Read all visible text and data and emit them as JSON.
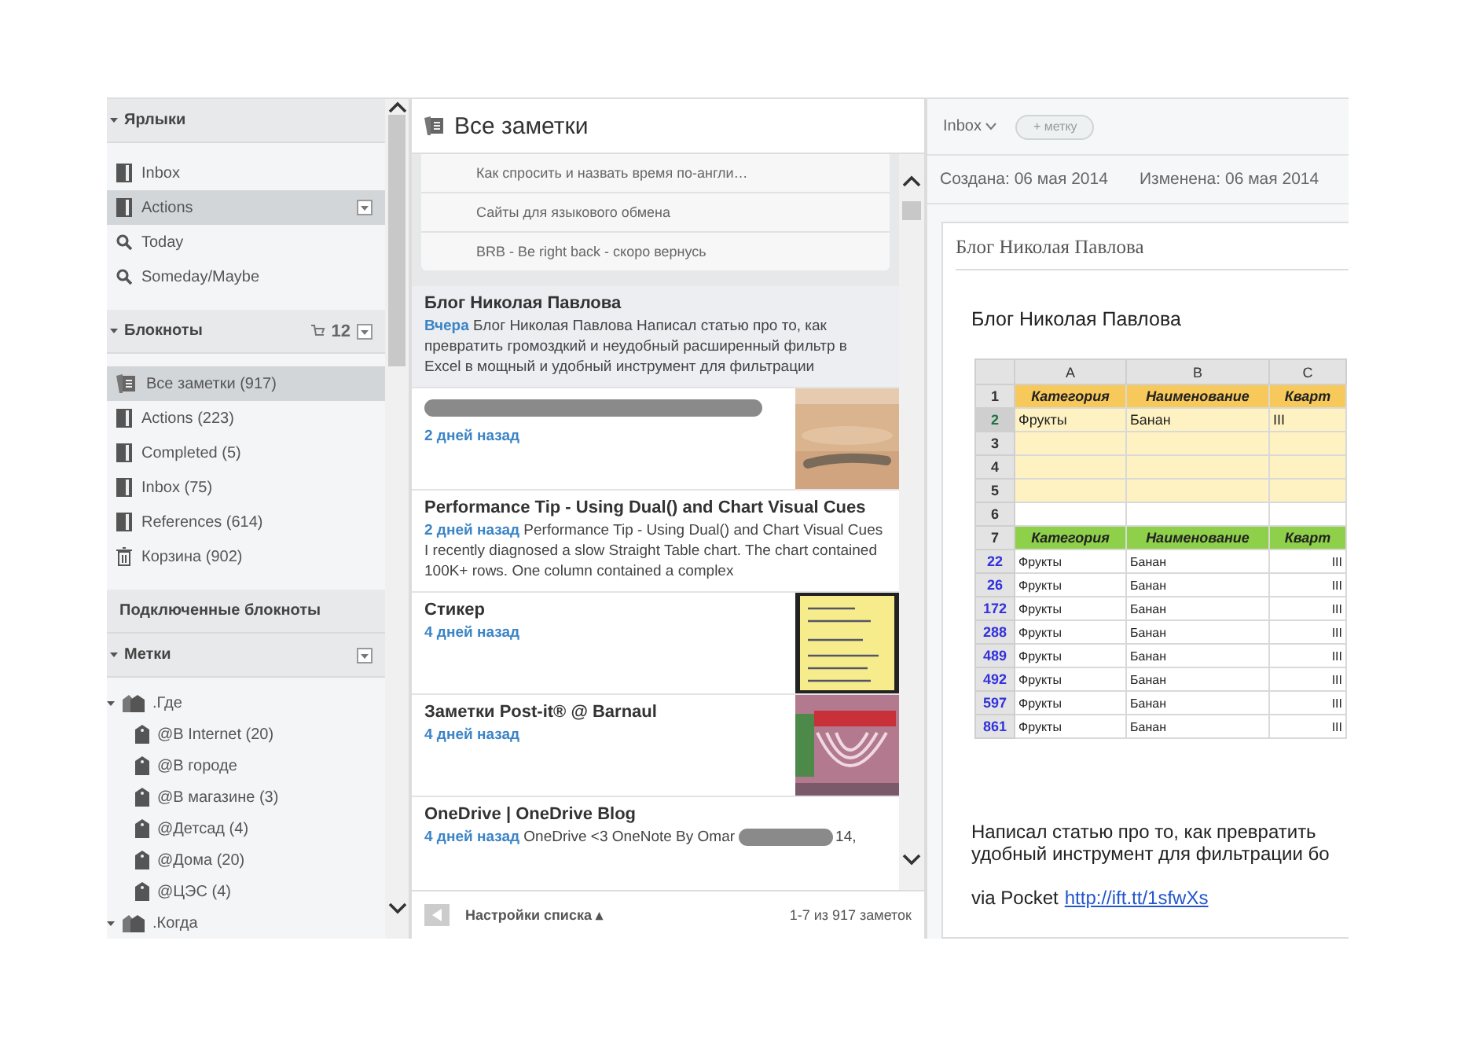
{
  "sidebar": {
    "shortcuts_header": "Ярлыки",
    "shortcuts": [
      {
        "label": "Inbox",
        "kind": "notebook",
        "selected": false
      },
      {
        "label": "Actions",
        "kind": "notebook",
        "selected": true
      },
      {
        "label": "Today",
        "kind": "search",
        "selected": false
      },
      {
        "label": "Someday/Maybe",
        "kind": "search",
        "selected": false
      }
    ],
    "notebooks_header": "Блокноты",
    "notebooks_count": "12",
    "notebooks": [
      {
        "label": "Все заметки (917)",
        "kind": "all",
        "selected": true
      },
      {
        "label": "Actions (223)",
        "kind": "notebook",
        "selected": false
      },
      {
        "label": "Completed (5)",
        "kind": "notebook",
        "selected": false
      },
      {
        "label": "Inbox (75)",
        "kind": "notebook",
        "selected": false
      },
      {
        "label": "References (614)",
        "kind": "notebook",
        "selected": false
      },
      {
        "label": "Корзина (902)",
        "kind": "trash",
        "selected": false
      }
    ],
    "linked_header": "Подключенные блокноты",
    "tags_header": "Метки",
    "tags": [
      {
        "label": ".Где",
        "children": [
          {
            "label": "@B Internet (20)"
          },
          {
            "label": "@B городе"
          },
          {
            "label": "@B магазине (3)"
          },
          {
            "label": "@Детсад (4)"
          },
          {
            "label": "@Дома (20)"
          },
          {
            "label": "@ЦЭС (4)"
          }
        ]
      },
      {
        "label": ".Когда"
      }
    ]
  },
  "list": {
    "title": "Все заметки",
    "recent": [
      "Как спросить и назвать время по-англи…",
      "Сайты для языкового обмена",
      "BRB - Be right back - скоро вернусь"
    ],
    "notes": [
      {
        "title": "Блог Николая Павлова",
        "date": "Вчера",
        "snippet": "Блог Николая Павлова Написал статью про то, как превратить громоздкий и неудобный расширенный фильтр в Excel в мощный и удобный инструмент для фильтрации",
        "selected": true
      },
      {
        "redacted_title": true,
        "date": "2 дней назад",
        "picture": true,
        "selected": false
      },
      {
        "title": "Performance Tip - Using Dual() and Chart Visual Cues",
        "date": "2 дней назад",
        "snippet": "Performance Tip - Using Dual() and Chart Visual Cues I recently diagnosed a slow Straight Table chart. The chart contained 100K+ rows. One column contained a complex",
        "selected": false
      },
      {
        "title": "Стикер",
        "date": "4 дней назад",
        "picture": true,
        "selected": false
      },
      {
        "title": "Заметки Post-it® @ Barnaul",
        "date": "4 дней назад",
        "picture": true,
        "selected": false
      },
      {
        "title": "OneDrive | OneDrive Blog",
        "date": "4 дней назад",
        "snippet": "OneDrive <3 OneNote By Omar",
        "snippet_tail": "14,",
        "selected": false
      }
    ],
    "settings": "Настройки списка ▴",
    "count": "1-7 из 917 заметок"
  },
  "note": {
    "notebook": "Inbox",
    "tag_button": "+ метку",
    "created": "Создана: 06 мая 2014",
    "modified": "Изменена: 06 мая 2014",
    "title": "Блог Николая Павлова",
    "heading": "Блог Николая Павлова",
    "sheet": {
      "columns": [
        "A",
        "B",
        "C"
      ],
      "rows": [
        {
          "num": "1",
          "kind": "yellow-header",
          "active": false,
          "cells": [
            "Категория",
            "Наименование",
            "Кварт"
          ]
        },
        {
          "num": "2",
          "kind": "yellow",
          "active": true,
          "cells": [
            "Фрукты",
            "Банан",
            "III"
          ]
        },
        {
          "num": "3",
          "kind": "yellow",
          "active": false,
          "cells": []
        },
        {
          "num": "4",
          "kind": "yellow",
          "active": false,
          "cells": []
        },
        {
          "num": "5",
          "kind": "yellow",
          "active": false,
          "cells": []
        },
        {
          "num": "6",
          "kind": "blank",
          "active": false,
          "cells": []
        },
        {
          "num": "7",
          "kind": "green-header",
          "active": false,
          "cells": [
            "Категория",
            "Наименование",
            "Кварт"
          ]
        },
        {
          "num": "22",
          "kind": "filtered",
          "active": false,
          "cells": [
            "Фрукты",
            "Банан",
            "III"
          ]
        },
        {
          "num": "26",
          "kind": "filtered",
          "active": false,
          "cells": [
            "Фрукты",
            "Банан",
            "III"
          ]
        },
        {
          "num": "172",
          "kind": "filtered",
          "active": false,
          "cells": [
            "Фрукты",
            "Банан",
            "III"
          ]
        },
        {
          "num": "288",
          "kind": "filtered",
          "active": false,
          "cells": [
            "Фрукты",
            "Банан",
            "III"
          ]
        },
        {
          "num": "489",
          "kind": "filtered",
          "active": false,
          "cells": [
            "Фрукты",
            "Банан",
            "III"
          ]
        },
        {
          "num": "492",
          "kind": "filtered",
          "active": false,
          "cells": [
            "Фрукты",
            "Банан",
            "III"
          ]
        },
        {
          "num": "597",
          "kind": "filtered",
          "active": false,
          "cells": [
            "Фрукты",
            "Банан",
            "III"
          ]
        },
        {
          "num": "861",
          "kind": "filtered",
          "active": false,
          "cells": [
            "Фрукты",
            "Банан",
            "III"
          ]
        }
      ]
    },
    "paragraph": [
      "Написал статью про то, как превратить",
      "удобный инструмент для фильтрации бо"
    ],
    "via": "via Pocket",
    "link": "http://ift.tt/1sfwXs"
  }
}
